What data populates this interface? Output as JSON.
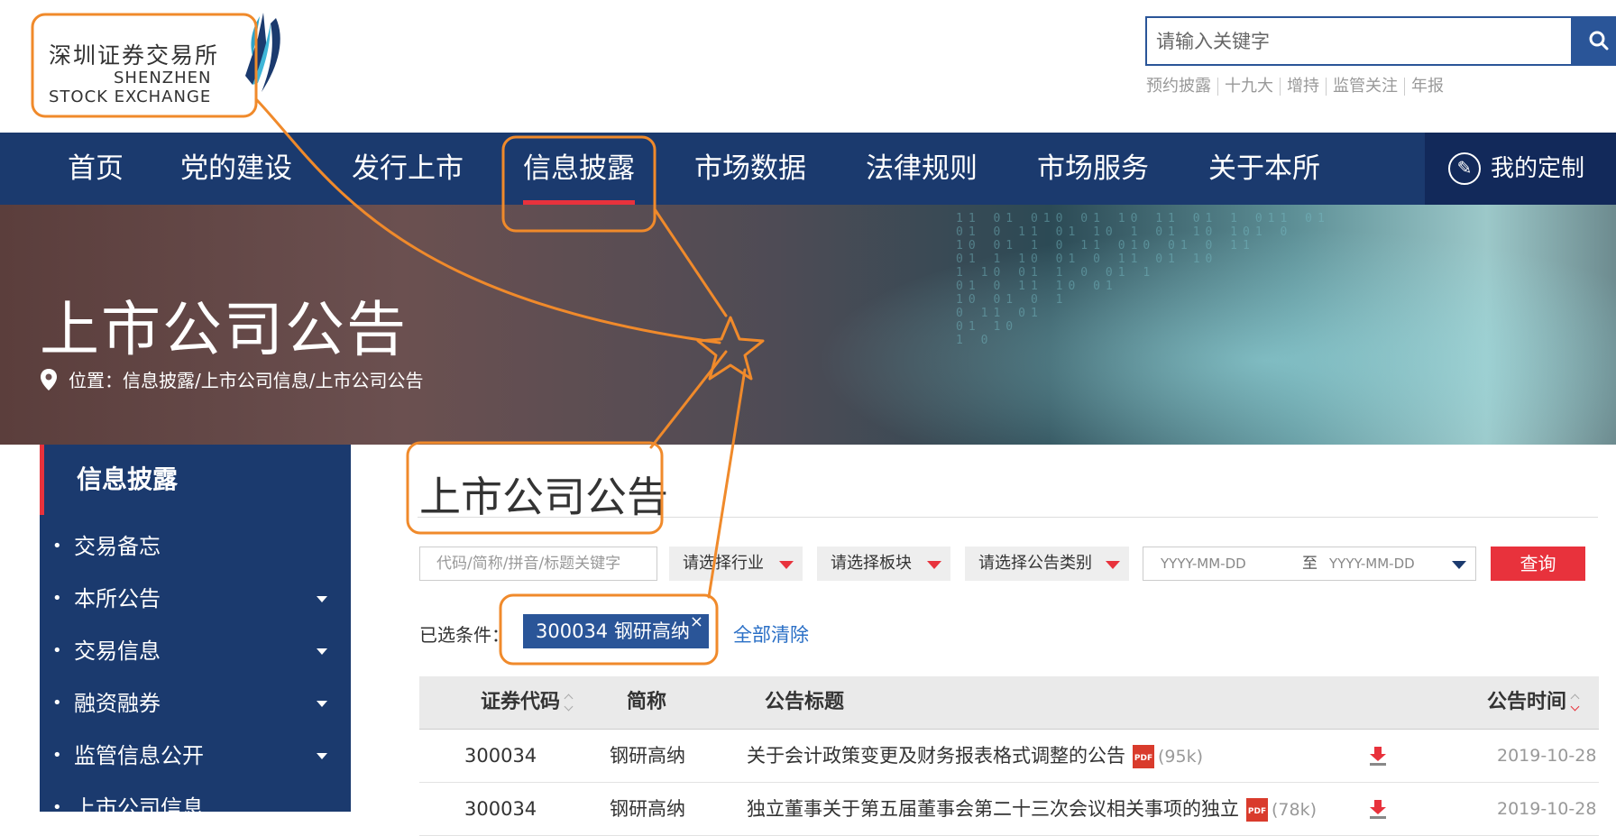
{
  "header": {
    "logo_cn": "深圳证券交易所",
    "logo_en_line1": "SHENZHEN",
    "logo_en_line2": "STOCK EXCHANGE",
    "search_placeholder": "请输入关键字",
    "hot_tags": [
      "预约披露",
      "十九大",
      "增持",
      "监管关注",
      "年报"
    ]
  },
  "nav": {
    "items": [
      "首页",
      "党的建设",
      "发行上市",
      "信息披露",
      "市场数据",
      "法律规则",
      "市场服务",
      "关于本所"
    ],
    "active": "信息披露",
    "custom_label": "我的定制"
  },
  "banner": {
    "title": "上市公司公告",
    "breadcrumb": "位置：信息披露/上市公司信息/上市公司公告"
  },
  "sidebar": {
    "title": "信息披露",
    "items": [
      {
        "label": "交易备忘",
        "expandable": false
      },
      {
        "label": "本所公告",
        "expandable": true
      },
      {
        "label": "交易信息",
        "expandable": true
      },
      {
        "label": "融资融券",
        "expandable": true
      },
      {
        "label": "监管信息公开",
        "expandable": true
      },
      {
        "label": "上市公司信息",
        "expandable": false
      }
    ]
  },
  "main": {
    "title": "上市公司公告",
    "filters": {
      "code_placeholder": "代码/简称/拼音/标题关键字",
      "industry": "请选择行业",
      "board": "请选择板块",
      "category": "请选择公告类别",
      "date_from": "YYYY-MM-DD",
      "date_to_label": "至",
      "date_to": "YYYY-MM-DD",
      "query": "查询"
    },
    "selected_label": "已选条件：",
    "selected_chip": "300034 钢研高纳",
    "clear_all": "全部清除",
    "table": {
      "headers": [
        "证券代码",
        "简称",
        "公告标题",
        "公告时间"
      ],
      "rows": [
        {
          "code": "300034",
          "name": "钢研高纳",
          "title": "关于会计政策变更及财务报表格式调整的公告",
          "size": "(95k)",
          "date": "2019-10-28"
        },
        {
          "code": "300034",
          "name": "钢研高纳",
          "title": "独立董事关于第五届董事会第二十三次会议相关事项的独立",
          "size": "(78k)",
          "date": "2019-10-28"
        }
      ]
    }
  },
  "colors": {
    "nav_bg": "#1b3a6e",
    "accent_red": "#e8323c",
    "chip_blue": "#2a5598",
    "annotation_orange": "#f08a2b"
  }
}
